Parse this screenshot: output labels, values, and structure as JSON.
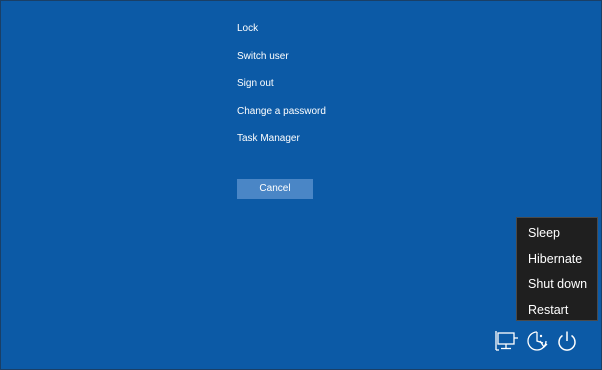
{
  "options_menu": {
    "items": [
      {
        "label": "Lock"
      },
      {
        "label": "Switch user"
      },
      {
        "label": "Sign out"
      },
      {
        "label": "Change a password"
      },
      {
        "label": "Task Manager"
      }
    ],
    "cancel_label": "Cancel"
  },
  "power_menu": {
    "items": [
      {
        "label": "Sleep"
      },
      {
        "label": "Hibernate"
      },
      {
        "label": "Shut down"
      },
      {
        "label": "Restart"
      }
    ]
  },
  "tray": {
    "icons": [
      "network-icon",
      "ease-of-access-icon",
      "power-icon"
    ]
  },
  "colors": {
    "background": "#0c5aa6",
    "button": "#4a86c6",
    "power_menu_bg": "#1f1f1f",
    "text": "#ffffff"
  }
}
